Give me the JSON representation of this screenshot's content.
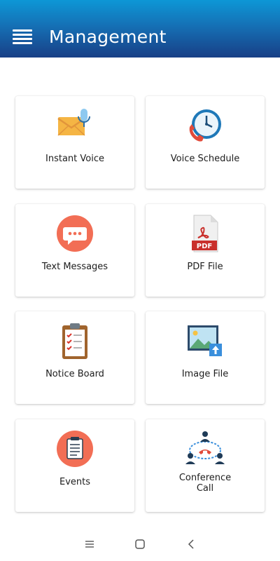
{
  "header": {
    "title": "Management",
    "menu_icon": "hamburger-menu-icon",
    "gradient": [
      "#0d97d6",
      "#183f86"
    ]
  },
  "tiles": [
    {
      "label": "Instant Voice",
      "icon": "envelope-microphone-icon"
    },
    {
      "label": "Voice Schedule",
      "icon": "clock-phone-icon"
    },
    {
      "label": "Text Messages",
      "icon": "chat-bubble-icon"
    },
    {
      "label": "PDF File",
      "icon": "pdf-file-icon",
      "icon_text": "PDF"
    },
    {
      "label": "Notice Board",
      "icon": "clipboard-checklist-icon"
    },
    {
      "label": "Image File",
      "icon": "image-upload-icon"
    },
    {
      "label": "Events",
      "icon": "notepad-icon"
    },
    {
      "label": "Conference\nCall",
      "label_lines": [
        "Conference",
        "Call"
      ],
      "icon": "conference-call-icon"
    }
  ],
  "system_nav": {
    "recents_icon": "recents-icon",
    "home_icon": "home-icon",
    "back_icon": "back-icon"
  }
}
